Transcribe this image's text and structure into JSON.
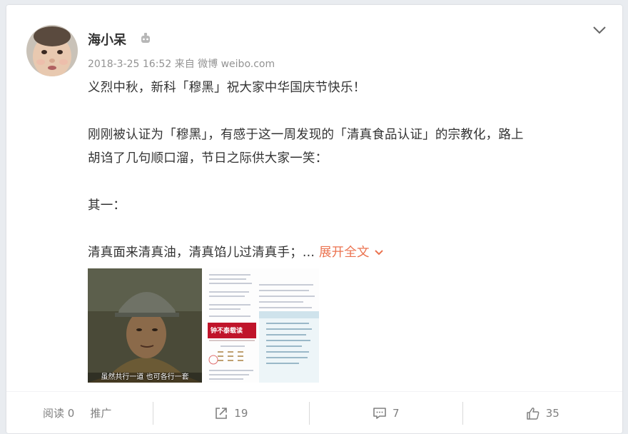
{
  "post": {
    "author": "海小呆",
    "timestamp": "2018-3-25 16:52",
    "source_prefix": "来自",
    "source": "微博 weibo.com",
    "lines": [
      "义烈中秋，新科「穆黑」祝大家中华国庆节快乐！",
      "",
      "刚刚被认证为「穆黑」，有感于这一周发现的「清真食品认证」的宗教化，路上",
      "胡诌了几句顺口溜，节日之际供大家一笑：",
      "",
      "其一："
    ],
    "last_line": "清真面来清真油，清真馅儿过清真手；...",
    "expand_label": "展开全文",
    "image1_caption": "虽然共行一道  也可各行一套",
    "image2_banner": "钟不泰载读"
  },
  "footer": {
    "views_label": "阅读 0",
    "promote_label": "推广",
    "share_count": "19",
    "comment_count": "7",
    "like_count": "35"
  },
  "colors": {
    "accent": "#eb7350",
    "text": "#333333",
    "meta": "#939393",
    "footer_text": "#808080"
  },
  "icons": [
    "vip-badge-icon",
    "chevron-down-icon",
    "share-icon",
    "comment-icon",
    "like-icon"
  ]
}
